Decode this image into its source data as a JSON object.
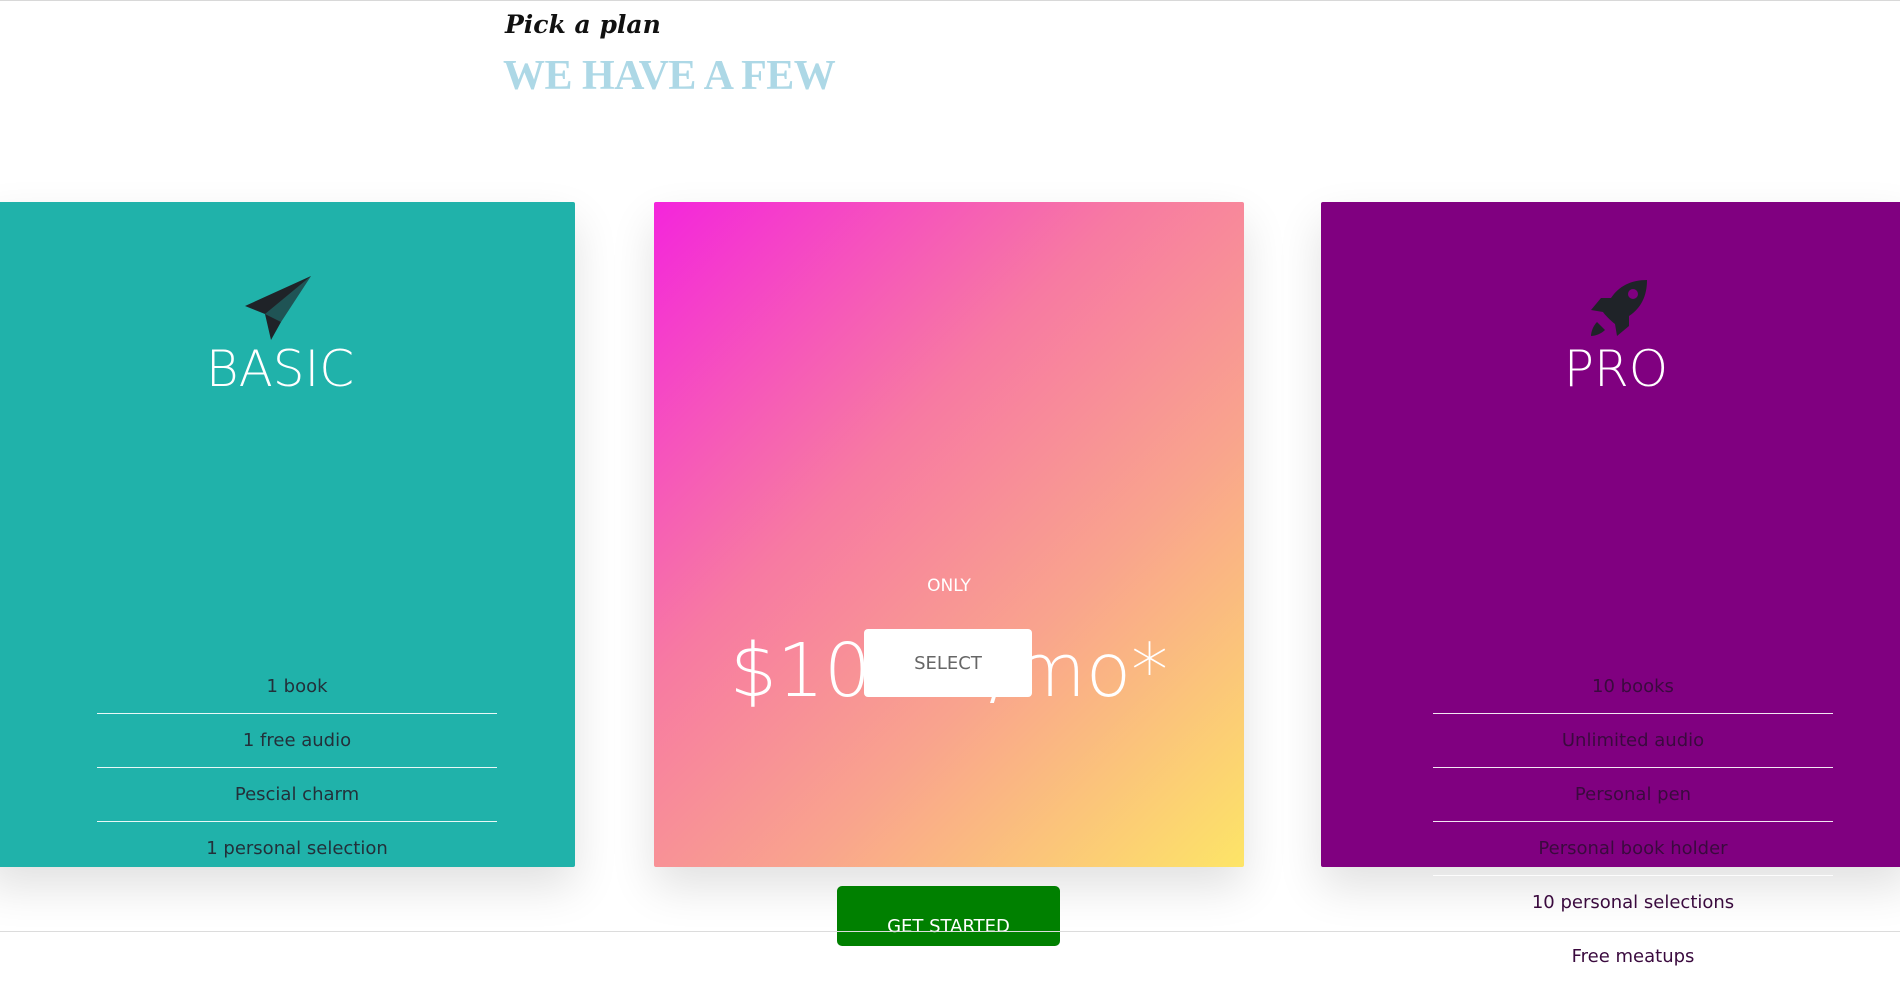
{
  "header": {
    "subtitle": "Pick a plan",
    "title": "WE HAVE A FEW"
  },
  "plans": {
    "basic": {
      "icon": "paper-plane-icon",
      "name": "BASIC",
      "features": [
        "1 book",
        "1 free audio",
        "Pescial charm",
        "1 personal selection"
      ],
      "color": "#20b2aa"
    },
    "featured": {
      "only_label": "ONLY",
      "price": "$10.25/mo*",
      "select_label": "SELECT",
      "gradient": [
        "#f425dc",
        "#fde567"
      ]
    },
    "pro": {
      "icon": "rocket-icon",
      "name": "PRO",
      "features": [
        "10 books",
        "Unlimited audio",
        "Personal pen",
        "Personal book holder",
        "10 personal selections",
        "Free meatups"
      ],
      "color": "#800080"
    }
  },
  "cta": {
    "label": "GET STARTED",
    "color": "#008000"
  }
}
